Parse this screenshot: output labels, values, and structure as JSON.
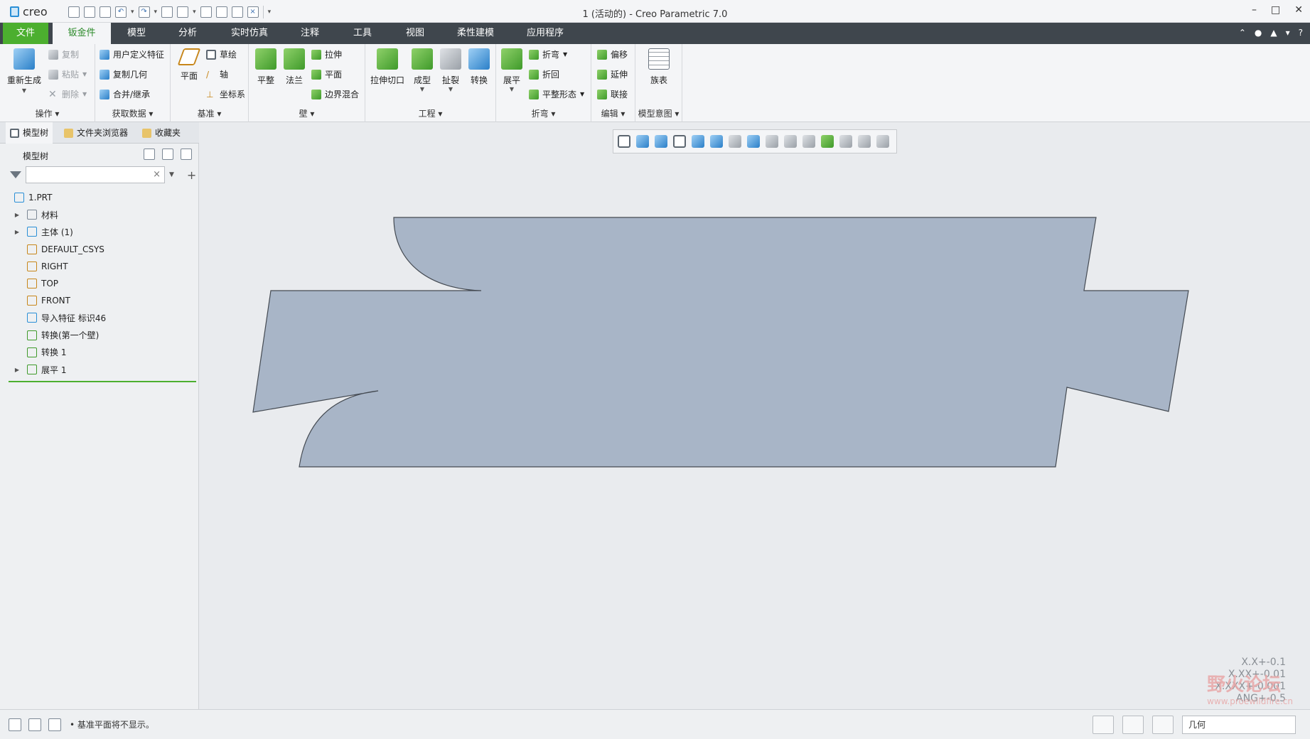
{
  "app": {
    "logo_text": "creo",
    "window_title": "1 (活动的) - Creo Parametric 7.0"
  },
  "colors": {
    "file_tab": "#4caf2f",
    "menubar": "#3f464d",
    "part_fill": "#a8b5c7",
    "accent_line": "#4caf2f"
  },
  "menu": {
    "tabs": [
      "文件",
      "钣金件",
      "模型",
      "分析",
      "实时仿真",
      "注释",
      "工具",
      "视图",
      "柔性建模",
      "应用程序"
    ],
    "active": "钣金件"
  },
  "ribbon": {
    "operations": {
      "label": "操作",
      "regenerate": "重新生成",
      "copy": "复制",
      "paste": "粘贴",
      "delete": "删除"
    },
    "get_data": {
      "label": "获取数据",
      "udf": "用户定义特征",
      "copy_geom": "复制几何",
      "merge": "合并/继承"
    },
    "datum": {
      "label": "基准",
      "plane": "平面",
      "sketch": "草绘",
      "axis": "轴",
      "csys": "坐标系"
    },
    "wall": {
      "label": "壁",
      "planar": "平整",
      "flange": "法兰",
      "extrude": "拉伸",
      "flat": "平面",
      "boundary": "边界混合"
    },
    "engineering": {
      "label": "工程",
      "extrude_cut": "拉伸切口",
      "form": "成型",
      "rip": "扯裂",
      "convert": "转换"
    },
    "bend": {
      "label": "折弯",
      "unbend": "展平",
      "bend": "折弯",
      "bend_back": "折回",
      "flatten_form": "平整形态"
    },
    "editing": {
      "label": "编辑",
      "offset": "偏移",
      "extend": "延伸",
      "join": "联接"
    },
    "model_intent": {
      "label": "模型意图",
      "family_table": "族表"
    }
  },
  "left_panel": {
    "tabs": [
      "模型树",
      "文件夹浏览器",
      "收藏夹"
    ],
    "tree_label": "模型树",
    "search_placeholder": "",
    "nodes": [
      {
        "label": "1.PRT",
        "expandable": false,
        "indent": 0
      },
      {
        "label": "材料",
        "expandable": true,
        "indent": 1
      },
      {
        "label": "主体 (1)",
        "expandable": true,
        "indent": 1
      },
      {
        "label": "DEFAULT_CSYS",
        "expandable": false,
        "indent": 1
      },
      {
        "label": "RIGHT",
        "expandable": false,
        "indent": 1
      },
      {
        "label": "TOP",
        "expandable": false,
        "indent": 1
      },
      {
        "label": "FRONT",
        "expandable": false,
        "indent": 1
      },
      {
        "label": "导入特征 标识46",
        "expandable": false,
        "indent": 1
      },
      {
        "label": "转换(第一个壁)",
        "expandable": false,
        "indent": 1
      },
      {
        "label": "转换 1",
        "expandable": false,
        "indent": 1
      },
      {
        "label": "展平 1",
        "expandable": true,
        "indent": 1
      }
    ]
  },
  "graphics": {
    "tolerances": [
      "X.X+-0.1",
      "X.XX+-0.01",
      "X.XXX+-0.001",
      "ANG+-0.5"
    ],
    "watermark": "野火论坛",
    "watermark_url": "www.proewildfire.cn"
  },
  "status": {
    "message": "• 基准平面将不显示。",
    "filter_value": "几何"
  }
}
